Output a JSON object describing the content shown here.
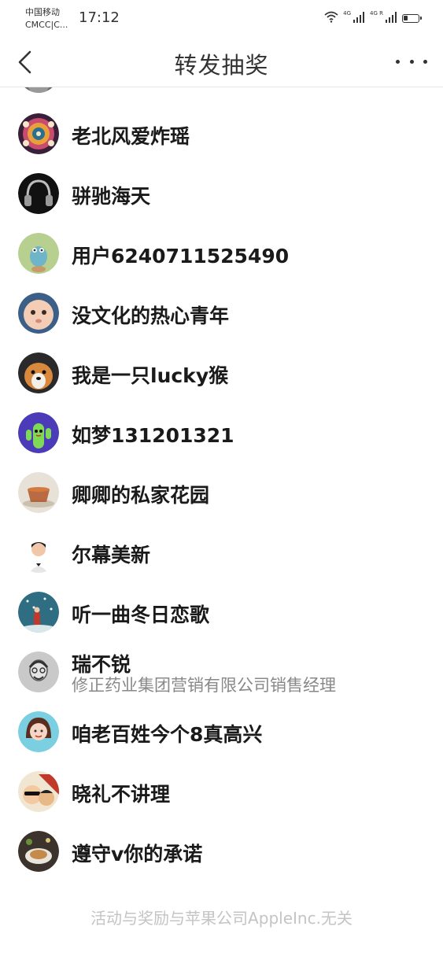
{
  "status_bar": {
    "carrier_line1": "中国移动",
    "carrier_line2": "CMCC|C...",
    "time": "17:12",
    "net1": "4G",
    "net2": "4G R",
    "battery_level": 0.3,
    "icons": [
      "wifi-icon",
      "signal-4g-icon",
      "signal-4g-roaming-icon",
      "battery-icon"
    ]
  },
  "nav": {
    "title": "转发抽奖",
    "back_icon": "chevron-left-icon",
    "more_icon": "more-horizontal-icon"
  },
  "users": [
    {
      "name": "老北风爱炸瑶",
      "avatar": "pattern-avatar"
    },
    {
      "name": "骈驰海天",
      "avatar": "headphones-avatar"
    },
    {
      "name": "用户6240711525490",
      "avatar": "default-bird-avatar"
    },
    {
      "name": "没文化的热心青年",
      "avatar": "baby-avatar"
    },
    {
      "name": "我是一只lucky猴",
      "avatar": "dog-avatar"
    },
    {
      "name": "如梦131201321",
      "avatar": "cactus-avatar"
    },
    {
      "name": "卿卿的私家花园",
      "avatar": "tea-cup-avatar"
    },
    {
      "name": "尔幕美新",
      "avatar": "man-portrait-avatar"
    },
    {
      "name": "听一曲冬日恋歌",
      "avatar": "snow-scene-avatar"
    },
    {
      "name": "瑞不锐",
      "desc": "修正药业集团营销有限公司销售经理",
      "avatar": "sketch-man-avatar"
    },
    {
      "name": "咱老百姓今个8真高兴",
      "avatar": "girl-portrait-avatar"
    },
    {
      "name": "晓礼不讲理",
      "avatar": "cartoon-avatar"
    },
    {
      "name": "遵守v你的承诺",
      "avatar": "food-avatar"
    }
  ],
  "footer": {
    "note": "活动与奖励与苹果公司AppleInc.无关"
  }
}
